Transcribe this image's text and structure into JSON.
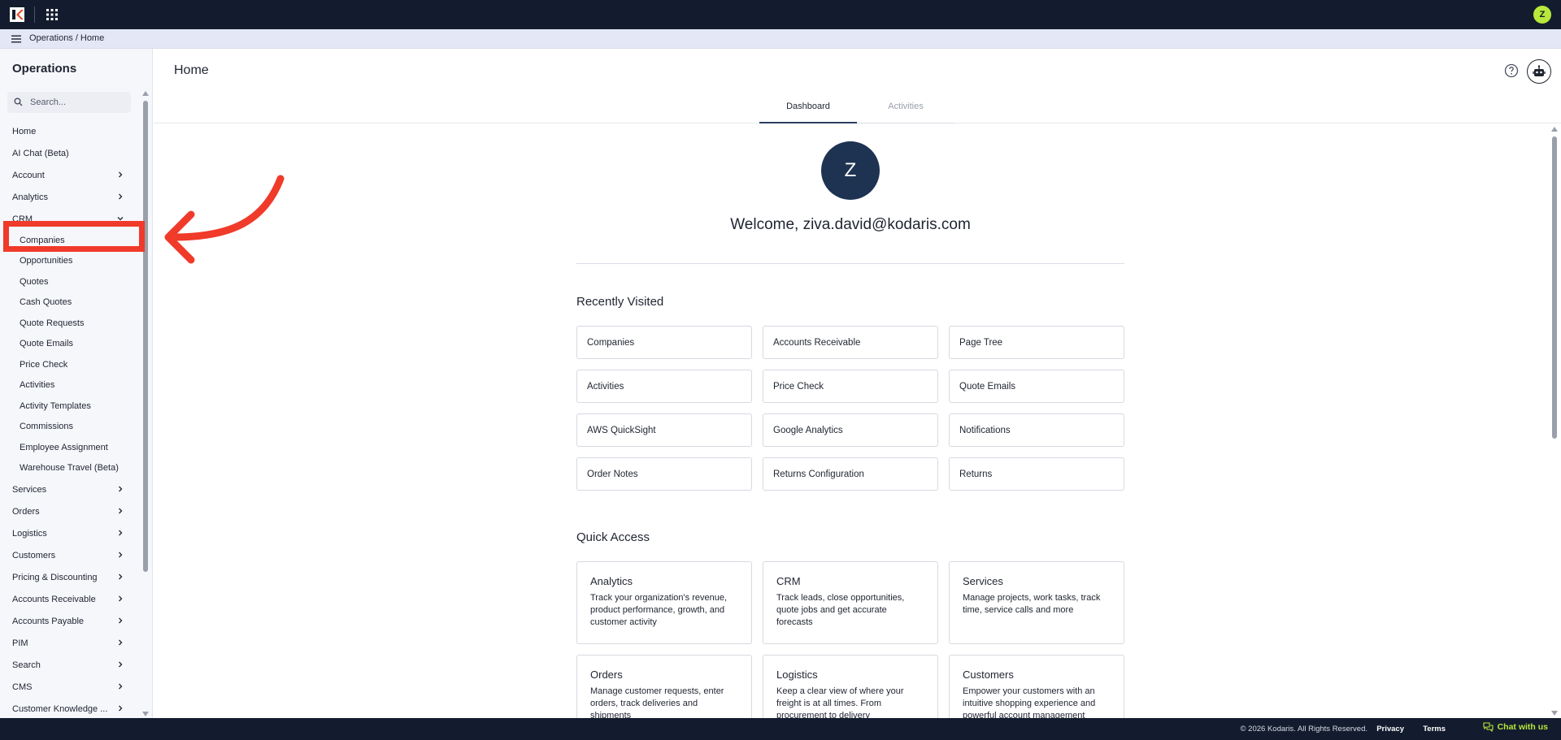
{
  "topbar": {
    "user_initial": "Z"
  },
  "breadcrumb": {
    "root": "Operations",
    "separator": "/",
    "current": "Home"
  },
  "sidebar": {
    "title": "Operations",
    "search_placeholder": "Search...",
    "items": [
      {
        "label": "Home",
        "chevron": false,
        "sub": false
      },
      {
        "label": "AI Chat (Beta)",
        "chevron": false,
        "sub": false
      },
      {
        "label": "Account",
        "chevron": "right",
        "sub": false
      },
      {
        "label": "Analytics",
        "chevron": "right",
        "sub": false
      },
      {
        "label": "CRM",
        "chevron": "down",
        "sub": false
      },
      {
        "label": "Companies",
        "chevron": false,
        "sub": true
      },
      {
        "label": "Opportunities",
        "chevron": false,
        "sub": true
      },
      {
        "label": "Quotes",
        "chevron": false,
        "sub": true
      },
      {
        "label": "Cash Quotes",
        "chevron": false,
        "sub": true
      },
      {
        "label": "Quote Requests",
        "chevron": false,
        "sub": true
      },
      {
        "label": "Quote Emails",
        "chevron": false,
        "sub": true
      },
      {
        "label": "Price Check",
        "chevron": false,
        "sub": true
      },
      {
        "label": "Activities",
        "chevron": false,
        "sub": true
      },
      {
        "label": "Activity Templates",
        "chevron": false,
        "sub": true
      },
      {
        "label": "Commissions",
        "chevron": false,
        "sub": true
      },
      {
        "label": "Employee Assignment",
        "chevron": false,
        "sub": true
      },
      {
        "label": "Warehouse Travel (Beta)",
        "chevron": false,
        "sub": true
      },
      {
        "label": "Services",
        "chevron": "right",
        "sub": false
      },
      {
        "label": "Orders",
        "chevron": "right",
        "sub": false
      },
      {
        "label": "Logistics",
        "chevron": "right",
        "sub": false
      },
      {
        "label": "Customers",
        "chevron": "right",
        "sub": false
      },
      {
        "label": "Pricing & Discounting",
        "chevron": "right",
        "sub": false
      },
      {
        "label": "Accounts Receivable",
        "chevron": "right",
        "sub": false
      },
      {
        "label": "Accounts Payable",
        "chevron": "right",
        "sub": false
      },
      {
        "label": "PIM",
        "chevron": "right",
        "sub": false
      },
      {
        "label": "Search",
        "chevron": "right",
        "sub": false
      },
      {
        "label": "CMS",
        "chevron": "right",
        "sub": false
      },
      {
        "label": "Customer Knowledge ...",
        "chevron": "right",
        "sub": false
      }
    ]
  },
  "main": {
    "title": "Home",
    "tabs": [
      {
        "label": "Dashboard",
        "active": true
      },
      {
        "label": "Activities",
        "active": false
      }
    ],
    "avatar_initial": "Z",
    "welcome": "Welcome, ziva.david@kodaris.com",
    "recently_visited_title": "Recently Visited",
    "recently_visited": [
      "Companies",
      "Accounts Receivable",
      "Page Tree",
      "Activities",
      "Price Check",
      "Quote Emails",
      "AWS QuickSight",
      "Google Analytics",
      "Notifications",
      "Order Notes",
      "Returns Configuration",
      "Returns"
    ],
    "quick_access_title": "Quick Access",
    "quick_access": [
      {
        "title": "Analytics",
        "desc": "Track your organization's revenue, product performance, growth, and customer activity"
      },
      {
        "title": "CRM",
        "desc": "Track leads, close opportunities, quote jobs and get accurate forecasts"
      },
      {
        "title": "Services",
        "desc": "Manage projects, work tasks, track time, service calls and more"
      },
      {
        "title": "Orders",
        "desc": "Manage customer requests, enter orders, track deliveries and shipments"
      },
      {
        "title": "Logistics",
        "desc": "Keep a clear view of where your freight is at all times. From procurement to delivery"
      },
      {
        "title": "Customers",
        "desc": "Empower your customers with an intuitive shopping experience and powerful account management"
      }
    ]
  },
  "footer": {
    "copyright": "© 2026 Kodaris. All Rights Reserved.",
    "privacy": "Privacy",
    "terms": "Terms",
    "chat": "Chat with us"
  },
  "colors": {
    "topbar": "#131c2e",
    "accent": "#b8e83a",
    "annotation": "#f03a2a",
    "avatar": "#1e3352"
  }
}
